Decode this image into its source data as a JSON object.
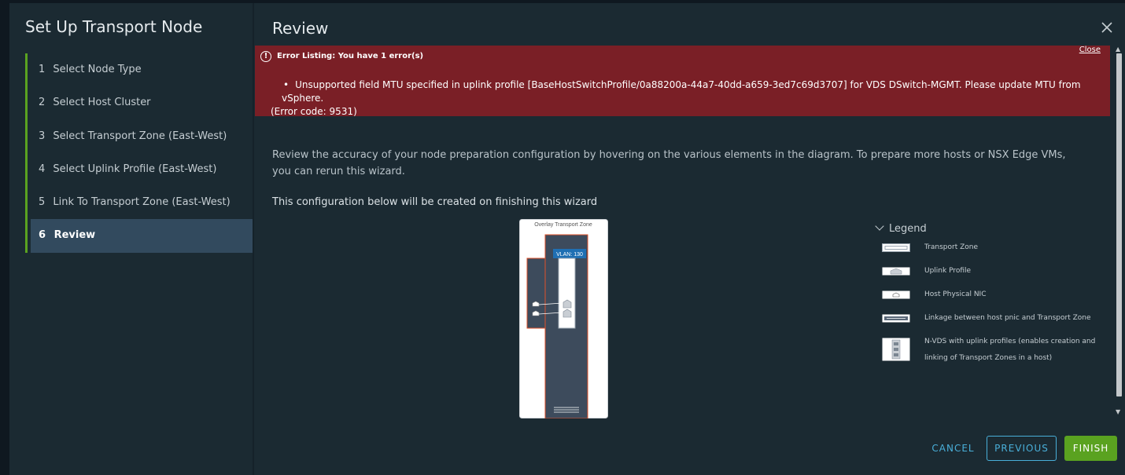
{
  "wizard": {
    "title": "Set Up Transport Node",
    "steps": [
      {
        "num": "1",
        "label": "Select Node Type"
      },
      {
        "num": "2",
        "label": "Select Host Cluster"
      },
      {
        "num": "3",
        "label": "Select Transport Zone (East-West)"
      },
      {
        "num": "4",
        "label": "Select Uplink Profile (East-West)"
      },
      {
        "num": "5",
        "label": "Link To Transport Zone (East-West)"
      },
      {
        "num": "6",
        "label": "Review"
      }
    ],
    "active_step": "6"
  },
  "review": {
    "title": "Review",
    "error": {
      "heading": "Error Listing: You have 1 error(s)",
      "close_label": "Close",
      "bullet": "•",
      "message_line1": "Unsupported field MTU specified in uplink profile [BaseHostSwitchProfile/0a88200a-44a7-40dd-a659-3ed7c69d3707] for VDS DSwitch-MGMT. Please update MTU from vSphere.",
      "message_line2": "(Error code: 9531)"
    },
    "description": "Review the accuracy of your node preparation configuration by hovering on the various elements in the diagram. To prepare more hosts or NSX Edge VMs, you can rerun this wizard.",
    "config_title": "This configuration below will be created on finishing this wizard",
    "diagram": {
      "zone_label": "Overlay Transport Zone",
      "vlan_label": "VLAN: 130"
    },
    "legend": {
      "title": "Legend",
      "items": [
        {
          "icon": "transport-zone-swatch",
          "label": "Transport Zone"
        },
        {
          "icon": "uplink-profile-swatch",
          "label": "Uplink Profile"
        },
        {
          "icon": "host-physical-nic-swatch",
          "label": "Host Physical NIC"
        },
        {
          "icon": "linkage-swatch",
          "label": "Linkage between host pnic and Transport Zone"
        },
        {
          "icon": "nvds-swatch",
          "label_line1": "N-VDS with uplink profiles (enables creation and",
          "label_line2": "linking of Transport Zones in a host)"
        }
      ]
    }
  },
  "footer": {
    "cancel_label": "CANCEL",
    "previous_label": "PREVIOUS",
    "finish_label": "FINISH"
  },
  "colors": {
    "accent_green": "#5aa220",
    "link_blue": "#49afd9",
    "error_red": "#7a1f26",
    "active_step_bg": "#324a5e"
  }
}
